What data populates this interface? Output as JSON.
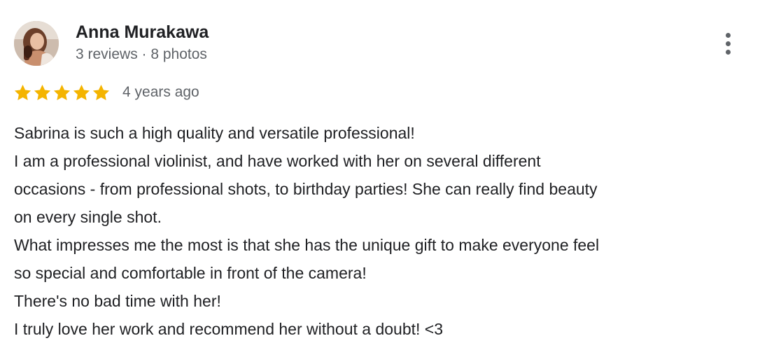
{
  "review": {
    "author": {
      "name": "Anna Murakawa",
      "meta": "3 reviews · 8 photos",
      "avatar_icon": "profile-photo"
    },
    "menu_icon": "more-vert-icon",
    "rating": {
      "stars": 5,
      "max_stars": 5,
      "star_color": "#f4b400",
      "date": "4 years ago"
    },
    "text_lines": [
      "Sabrina is such a high quality and versatile professional!",
      "I am a professional violinist, and have worked with her on several different",
      "occasions - from professional shots, to birthday parties! She can really find beauty",
      "on every single shot.",
      "What impresses me the most is that she has the unique gift to make everyone feel",
      "so special and comfortable in front of the camera!",
      "There's no bad time with her!",
      "I truly love her work and recommend her without a doubt! <3"
    ]
  }
}
